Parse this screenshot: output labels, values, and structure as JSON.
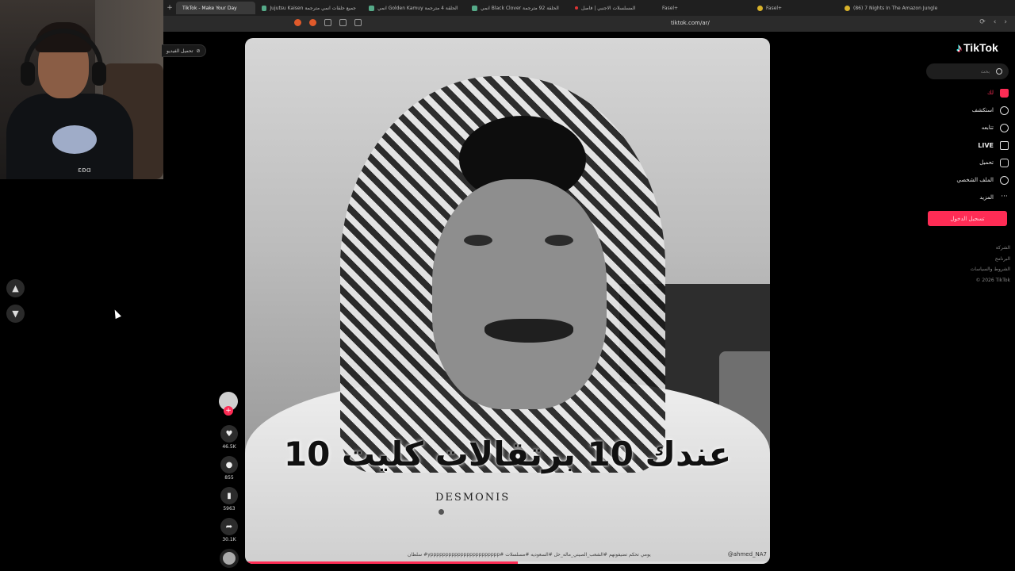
{
  "browser": {
    "tabs": [
      {
        "label": "TikTok - Make Your Day",
        "active": true,
        "color": "#333"
      },
      {
        "label": "Jujutsu Kaisen جميع حلقات انمي مترجمة",
        "active": false,
        "color": "#5a8"
      },
      {
        "label": "انمي Golden Kamuy الحلقة 4 مترجمة",
        "active": false,
        "color": "#5a8"
      },
      {
        "label": "انمي Black Clover الحلقة 92 مترجمة",
        "active": false,
        "color": "#5a8"
      },
      {
        "label": "المسلسلات الاجنبي | فاصل",
        "active": false,
        "color": "#d33"
      },
      {
        "label": "Fasel+",
        "active": false,
        "color": "#d8b22a"
      },
      {
        "label": "Fasel+",
        "active": false,
        "color": "#d8b22a"
      },
      {
        "label": "(86) 7 Nights In The Amazon Jungle",
        "active": false,
        "color": "#d8b22a"
      }
    ],
    "new_tab": "+",
    "url": "tiktok.com/ar/"
  },
  "download_pill": "تحميل الفيديو",
  "nav": {
    "up": "▲",
    "down": "▼"
  },
  "video": {
    "caption": "عندك 10 برتقالات كليت 10",
    "watermark": "DESMONIS",
    "description": "سلطان #yppppppppppppppppppppppp# يومي تحكم تضيفونهم #الشعب_الصيني_ماله_حل #السعوديه #مسلسلات",
    "author": "@ahmed_NA7",
    "progress": 0.52
  },
  "actions": {
    "likes": "46.5K",
    "comments": "855",
    "saves": "5963",
    "shares": "30.1K",
    "plus": "+"
  },
  "tiktok": {
    "brand": "TikTok",
    "search_placeholder": "بحث",
    "menu": [
      {
        "label": "لك",
        "active": true
      },
      {
        "label": "استكشف",
        "active": false
      },
      {
        "label": "تتابعه",
        "active": false
      },
      {
        "label": "LIVE",
        "active": false
      },
      {
        "label": "تحميل",
        "active": false
      },
      {
        "label": "الملف الشخصي",
        "active": false
      },
      {
        "label": "المزيد",
        "active": false
      }
    ],
    "login_button": "تسجيل الدخول",
    "footer": [
      "الشركة",
      "البرنامج",
      "الشروط والسياسات",
      "© 2026 TikTok"
    ]
  },
  "webcam": {
    "shirt_text": "ɛʚɑ"
  },
  "colors": {
    "accent": "#fe2c55",
    "background": "#000000"
  }
}
